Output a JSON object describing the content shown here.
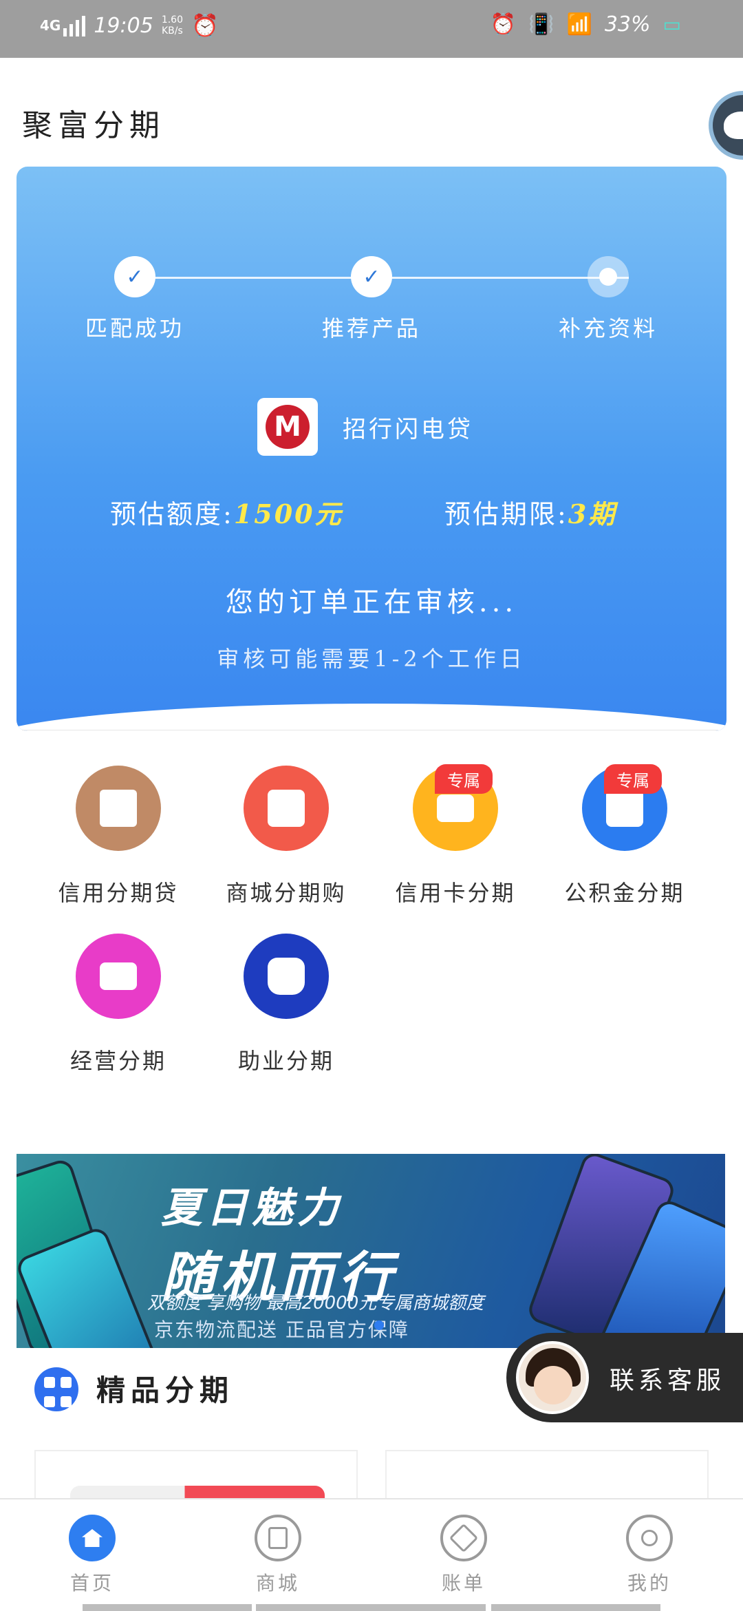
{
  "status_bar": {
    "network": "4G",
    "time": "19:05",
    "speed_value": "1.60",
    "speed_unit": "KB/s",
    "battery": "33%"
  },
  "header": {
    "title": "聚富分期"
  },
  "hero": {
    "steps": [
      {
        "label": "匹配成功",
        "state": "done"
      },
      {
        "label": "推荐产品",
        "state": "done"
      },
      {
        "label": "补充资料",
        "state": "pending"
      }
    ],
    "product_logo_text": "M",
    "product_name": "招行闪电贷",
    "limit_label": "预估额度:",
    "limit_value": "1500元",
    "term_label": "预估期限:",
    "term_value": "3期",
    "review_title": "您的订单正在审核...",
    "review_subtitle": "审核可能需要1-2个工作日"
  },
  "menu": {
    "items": [
      {
        "label": "信用分期贷",
        "color": "#c08a66",
        "badge": ""
      },
      {
        "label": "商城分期购",
        "color": "#f25a4a",
        "badge": ""
      },
      {
        "label": "信用卡分期",
        "color": "#ffb41e",
        "badge": "专属"
      },
      {
        "label": "公积金分期",
        "color": "#2b7cf0",
        "badge": "专属"
      },
      {
        "label": "经营分期",
        "color": "#e83cc8",
        "badge": ""
      },
      {
        "label": "助业分期",
        "color": "#1e3cbf",
        "badge": ""
      }
    ]
  },
  "banner": {
    "title_line1": "夏日魅力",
    "title_line2": "随机而行",
    "line1": "双额度 享购物 最高20000元专属商城额度",
    "line2": "京东物流配送 正品官方保障"
  },
  "section": {
    "title": "精品分期"
  },
  "customer_service": {
    "label": "联系客服"
  },
  "tabbar": {
    "tabs": [
      {
        "label": "首页",
        "active": true
      },
      {
        "label": "商城",
        "active": false
      },
      {
        "label": "账单",
        "active": false
      },
      {
        "label": "我的",
        "active": false
      }
    ]
  }
}
